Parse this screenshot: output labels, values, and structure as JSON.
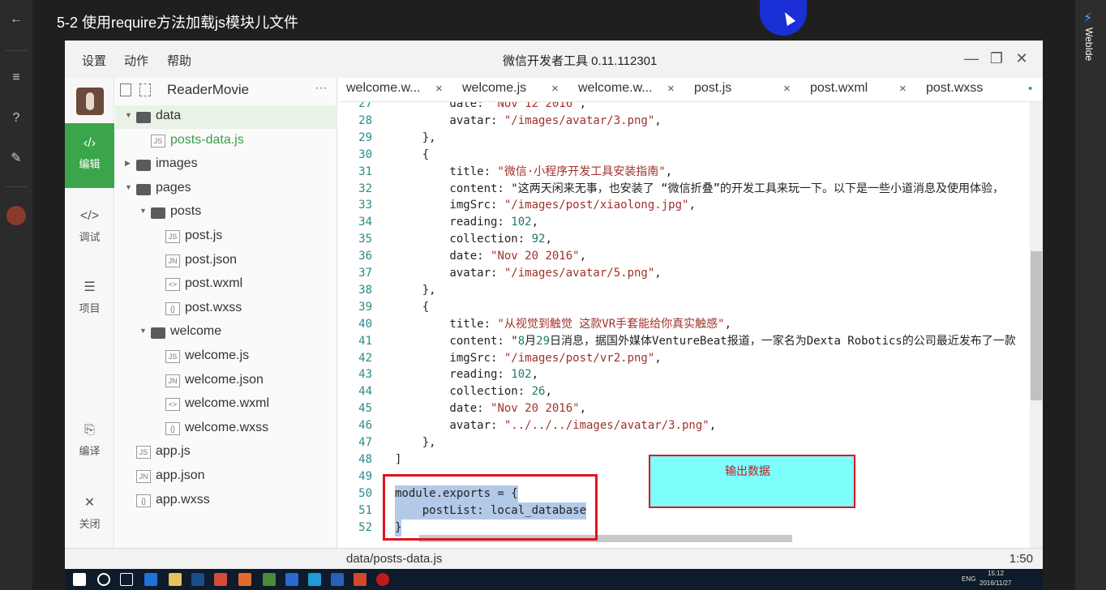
{
  "player": {
    "title": "5-2 使用require方法加载js模块儿文件",
    "right_label": "WebIde",
    "left_icons": [
      "back-arrow-icon",
      "menu-icon",
      "help-icon",
      "pen-icon",
      "avatar-icon"
    ]
  },
  "window": {
    "menu": [
      "设置",
      "动作",
      "帮助"
    ],
    "title": "微信开发者工具 0.11.112301",
    "controls": [
      "minimize",
      "restore",
      "close"
    ]
  },
  "rail": [
    {
      "icon": "code-icon",
      "label": "编辑",
      "active": true
    },
    {
      "icon": "debug-icon",
      "label": "调试",
      "active": false
    },
    {
      "icon": "list-icon",
      "label": "项目",
      "active": false
    },
    {
      "icon": "compile-icon",
      "label": "编译",
      "active": false
    },
    {
      "icon": "close-icon",
      "label": "关闭",
      "active": false
    }
  ],
  "tree": {
    "project": "ReaderMovie",
    "more": "···",
    "items": [
      {
        "label": "data",
        "type": "folder",
        "open": true
      },
      {
        "label": "posts-data.js",
        "type": "js",
        "badge": "JS"
      },
      {
        "label": "images",
        "type": "folder",
        "open": false
      },
      {
        "label": "pages",
        "type": "folder",
        "open": true
      },
      {
        "label": "posts",
        "type": "folder",
        "open": true
      },
      {
        "label": "post.js",
        "type": "js",
        "badge": "JS"
      },
      {
        "label": "post.json",
        "type": "json",
        "badge": "JN"
      },
      {
        "label": "post.wxml",
        "type": "wxml",
        "badge": "<>"
      },
      {
        "label": "post.wxss",
        "type": "wxss",
        "badge": "{}"
      },
      {
        "label": "welcome",
        "type": "folder",
        "open": true
      },
      {
        "label": "welcome.js",
        "type": "js",
        "badge": "JS"
      },
      {
        "label": "welcome.json",
        "type": "json",
        "badge": "JN"
      },
      {
        "label": "welcome.wxml",
        "type": "wxml",
        "badge": "<>"
      },
      {
        "label": "welcome.wxss",
        "type": "wxss",
        "badge": "{}"
      },
      {
        "label": "app.js",
        "type": "js",
        "badge": "JS"
      },
      {
        "label": "app.json",
        "type": "json",
        "badge": "JN"
      },
      {
        "label": "app.wxss",
        "type": "wxss",
        "badge": "{}"
      }
    ]
  },
  "tabs": [
    {
      "label": "welcome.w...",
      "close": "×"
    },
    {
      "label": "welcome.js",
      "close": "×"
    },
    {
      "label": "welcome.w...",
      "close": "×"
    },
    {
      "label": "post.js",
      "close": "×"
    },
    {
      "label": "post.wxml",
      "close": "×"
    },
    {
      "label": "post.wxss",
      "close": "•"
    }
  ],
  "code": [
    {
      "n": "27",
      "text": "        date: \"Nov 12 2016\","
    },
    {
      "n": "28",
      "text": "        avatar: \"/images/avatar/3.png\","
    },
    {
      "n": "29",
      "text": "    },"
    },
    {
      "n": "30",
      "text": "    {"
    },
    {
      "n": "31",
      "text": "        title: \"微信·小程序开发工具安装指南\","
    },
    {
      "n": "32",
      "text": "        content: \"这两天闲来无事，也安装了 “微信折叠”的开发工具来玩一下。以下是一些小道消息及使用体验，"
    },
    {
      "n": "33",
      "text": "        imgSrc: \"/images/post/xiaolong.jpg\","
    },
    {
      "n": "34",
      "text": "        reading: 102,"
    },
    {
      "n": "35",
      "text": "        collection: 92,"
    },
    {
      "n": "36",
      "text": "        date: \"Nov 20 2016\","
    },
    {
      "n": "37",
      "text": "        avatar: \"/images/avatar/5.png\","
    },
    {
      "n": "38",
      "text": "    },"
    },
    {
      "n": "39",
      "text": "    {"
    },
    {
      "n": "40",
      "text": "        title: \"从视觉到触觉 这款VR手套能给你真实触感\","
    },
    {
      "n": "41",
      "text": "        content: \"8月29日消息，据国外媒体VentureBeat报道，一家名为Dexta Robotics的公司最近发布了一款"
    },
    {
      "n": "42",
      "text": "        imgSrc: \"/images/post/vr2.png\","
    },
    {
      "n": "43",
      "text": "        reading: 102,"
    },
    {
      "n": "44",
      "text": "        collection: 26,"
    },
    {
      "n": "45",
      "text": "        date: \"Nov 20 2016\","
    },
    {
      "n": "46",
      "text": "        avatar: \"../../../images/avatar/3.png\","
    },
    {
      "n": "47",
      "text": "    },"
    },
    {
      "n": "48",
      "text": "]"
    },
    {
      "n": "49",
      "text": ""
    },
    {
      "n": "50",
      "text": "module.exports = {",
      "highlight": true
    },
    {
      "n": "51",
      "text": "    postList: local_database",
      "highlight": true
    },
    {
      "n": "52",
      "text": "}",
      "highlight": true
    }
  ],
  "annotation": {
    "label": "输出数据"
  },
  "status": {
    "path": "data/posts-data.js",
    "position": "1:50"
  },
  "taskbar": {
    "time": "15:12",
    "date": "2016/11/27",
    "lang": "ENG"
  },
  "colors": {
    "accent": "#3aa54b",
    "annotation_bg": "#7dfdfb",
    "annotation_border": "#e0141e"
  }
}
